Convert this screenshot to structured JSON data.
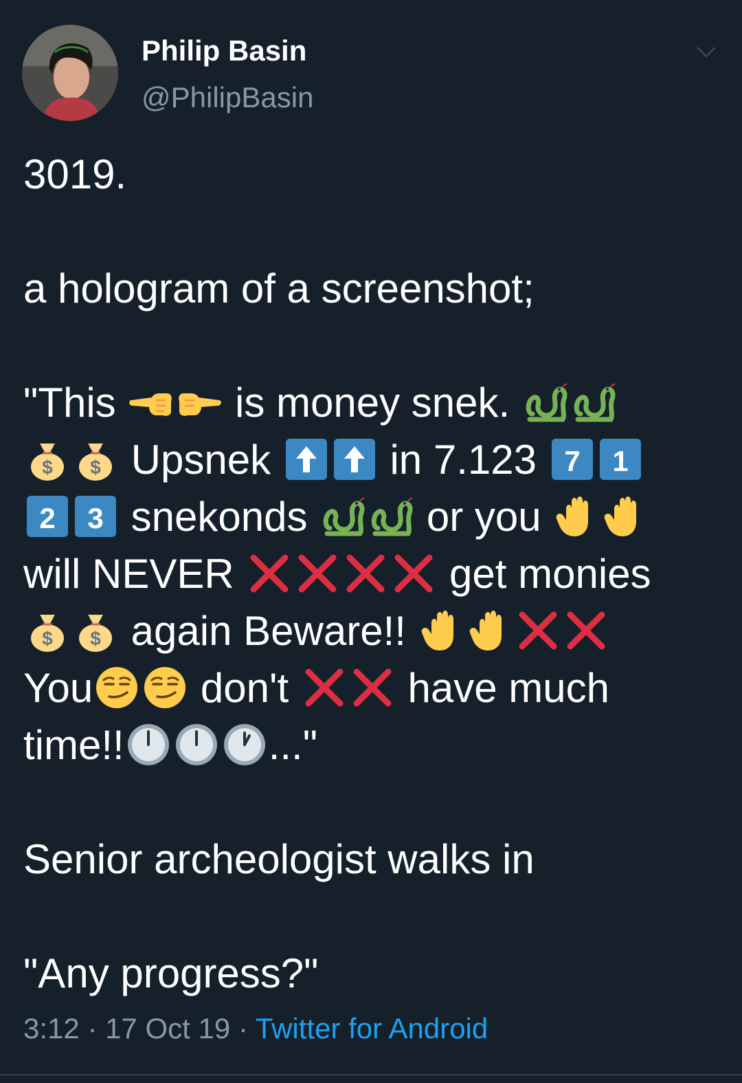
{
  "author": {
    "name": "Philip Basin",
    "handle": "@PhilipBasin",
    "avatar_icon": "profile-photo"
  },
  "menu": {
    "icon": "chevron-down-icon"
  },
  "tweet": {
    "line_year": "3019.",
    "line_hologram": "a hologram of a screenshot;",
    "quote": {
      "l1_t1": "\"This ",
      "l1_t2": " is money snek. ",
      "l2_t1": " Upsnek ",
      "l2_t2": " in 7.123 ",
      "l3_t1": " snekonds ",
      "l3_t2": " or you ",
      "l4_t1": "will NEVER ",
      "l4_t2": " get monies",
      "l5_t1": " again Beware!! ",
      "l6_t1": "You",
      "l6_t2": " don't ",
      "l6_t3": " have much",
      "l7_t1": "time!!",
      "l7_t2": "...\""
    },
    "line_senior": "Senior archeologist walks in",
    "line_progress": "\"Any progress?\"",
    "emoji_names": [
      "backhand-pointing-left",
      "pointing-right",
      "snake",
      "money-bag",
      "up-arrow-button",
      "keycap-7",
      "keycap-1",
      "keycap-2",
      "keycap-3",
      "raised-hand",
      "cross-mark",
      "smirking-face",
      "clock-twelve",
      "clock-one"
    ]
  },
  "meta": {
    "time": "3:12",
    "sep1": " · ",
    "date": "17 Oct 19",
    "sep2": " · ",
    "source": "Twitter for Android"
  },
  "colors": {
    "background": "#15202b",
    "text_primary": "#ffffff",
    "text_secondary": "#8899a6",
    "link": "#1da1f2",
    "cross": "#dd2e44",
    "snake": "#77b255",
    "hand": "#ffcc4d",
    "keycap": "#3b88c3"
  }
}
